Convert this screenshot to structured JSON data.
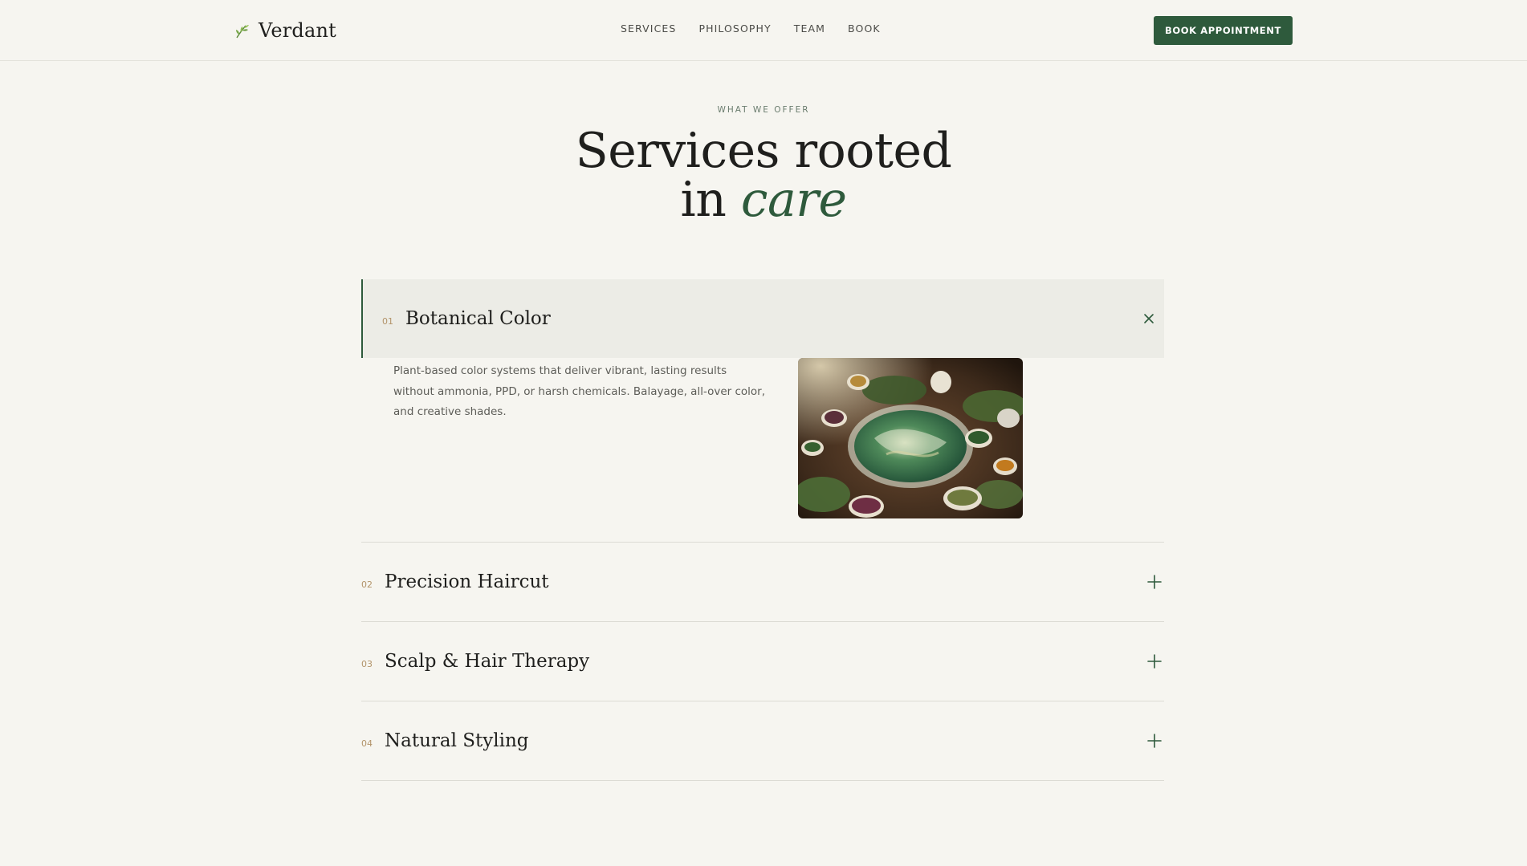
{
  "brand": {
    "name": "Verdant",
    "logo_icon": "leaf-icon"
  },
  "nav": {
    "links": [
      "SERVICES",
      "PHILOSOPHY",
      "TEAM",
      "BOOK"
    ],
    "cta_label": "BOOK APPOINTMENT"
  },
  "hero": {
    "eyebrow": "WHAT WE OFFER",
    "title_line1": "Services rooted",
    "title_line2_prefix": "in ",
    "title_line2_accent": "care"
  },
  "services": [
    {
      "number": "01",
      "title": "Botanical Color",
      "expanded": true,
      "toggle_icon": "close-icon",
      "description": "Plant-based color systems that deliver vibrant, lasting results without ammonia, PPD, or harsh chemicals. Balayage, all-over color, and creative shades.",
      "image": "botanical-color-image"
    },
    {
      "number": "02",
      "title": "Precision Haircut",
      "expanded": false,
      "toggle_icon": "plus-icon"
    },
    {
      "number": "03",
      "title": "Scalp & Hair Therapy",
      "expanded": false,
      "toggle_icon": "plus-icon"
    },
    {
      "number": "04",
      "title": "Natural Styling",
      "expanded": false,
      "toggle_icon": "plus-icon"
    }
  ],
  "colors": {
    "background": "#f6f5f0",
    "accent_green": "#2e5a3c",
    "number_gold": "#b3946a",
    "open_row_bg": "#ecece6"
  }
}
